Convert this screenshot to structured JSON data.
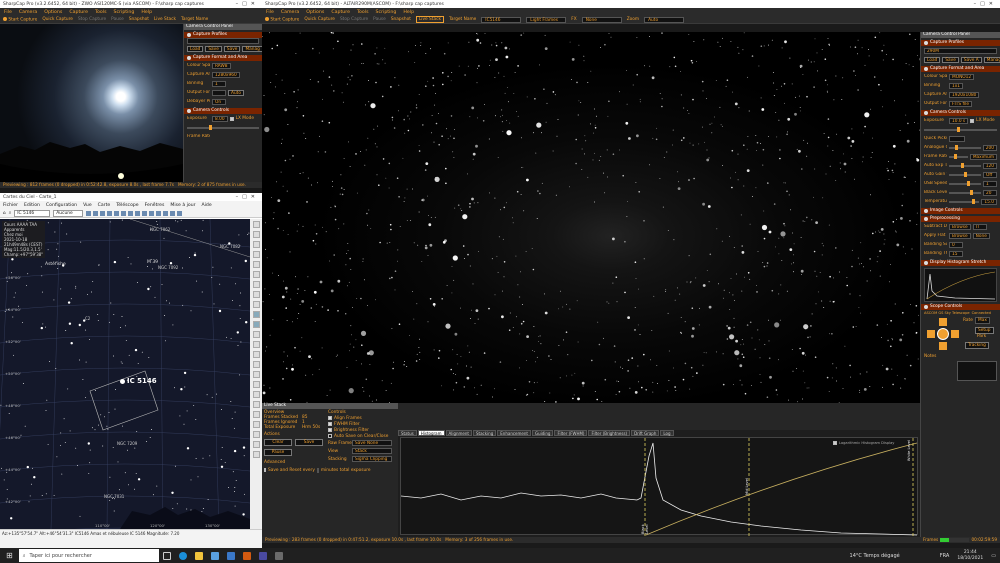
{
  "left_window": {
    "title": "SharpCap Pro (v3.2.6452, 64 bit) - ZWO ASI120MC-S (via ASCOM) - F:\\sharp cap captures",
    "menu": [
      "File",
      "Camera",
      "Options",
      "Capture",
      "Tools",
      "Scripting",
      "Help"
    ],
    "toolbar": {
      "start": "Start Capture",
      "quick": "Quick Capture",
      "stop": "Stop Capture",
      "pause": "Pause",
      "snapshot": "Snapshot",
      "live": "Live Stack",
      "target": "Target Name"
    },
    "panel": {
      "title": "Camera Control Panel",
      "profiles": "Capture Profiles",
      "buttons": [
        "Load",
        "Save",
        "Save",
        "Manag"
      ],
      "format_header": "Capture Format and Area",
      "rows": [
        {
          "label": "Colour Space",
          "value": "RAW8"
        },
        {
          "label": "Capture Area",
          "value": "1280x960"
        },
        {
          "label": "Binning",
          "value": "1"
        },
        {
          "label": "Output Format",
          "value": "",
          "btn": "Auto"
        },
        {
          "label": "Debayer Preview",
          "value": "On"
        }
      ],
      "controls_header": "Camera Controls",
      "exposure_label": "Exposure",
      "exposure_value": "8.00",
      "lx": "LX Mode",
      "frame_rate": "Frame Rate"
    },
    "status": "Previewing : 812 frames (0 dropped) in 0:52:42.8, exposure 8.0s , last frame 7.7s",
    "memory": "Memory: 2 of 875 frames in use."
  },
  "cdc_window": {
    "title": "Cartes du Ciel - Carte_1",
    "menu": [
      "Fichier",
      "Edition",
      "Configuration",
      "Vue",
      "Carte",
      "Téléscope",
      "Fenêtres",
      "Mise à jour",
      "Aide"
    ],
    "search_value": "IC 5146",
    "projection": "Aucune",
    "info": [
      "Cours AAAA TAA",
      "Apparents",
      "Chez moi",
      "2021-10-18",
      "21h49m48s (CEST)",
      "Mag:11.5/20.3,1.5'",
      "Champ:+97°59'38\""
    ],
    "labels": {
      "asterisme": "Astéfishe",
      "ngc7062": "NGC 7062",
      "m39": "M 39",
      "ngc7082": "NGC 7082",
      "ngc7092": "NGC 7092",
      "target": "IC 5146",
      "ngc7209": "NGC 7209",
      "ngc7031": "NGC 7031",
      "c2": "C2"
    },
    "dec_labels": [
      "+56°00'",
      "+54°00'",
      "+52°00'",
      "+50°00'",
      "+48°00'",
      "+46°00'",
      "+44°00'",
      "+42°00'",
      "+40°00'"
    ],
    "ra_labels": [
      "110°00'",
      "120°00'",
      "130°00'"
    ],
    "status": "Az:+135°57'54.7\" Alt:+46°54'31.3\"   IC5146  Amas et nébuleuse  IC 5146  Magnitude: 7.20"
  },
  "right_window": {
    "title": "SharpCap Pro (v3.2.6452, 64 bit) - ALTAIR290M(ASCOM) - F:\\sharp cap captures",
    "menu": [
      "File",
      "Camera",
      "Options",
      "Capture",
      "Tools",
      "Scripting",
      "Help"
    ],
    "toolbar": {
      "start": "Start Capture",
      "quick": "Quick Capture",
      "stop": "Stop Capture",
      "pause": "Pause",
      "snapshot": "Snapshot",
      "live": "Live Stack",
      "target_label": "Target Name",
      "target_value": "IC5146",
      "frames": "Light Frames",
      "fx_label": "FX",
      "fx_value": "None",
      "zoom_label": "Zoom",
      "zoom_value": "Auto"
    },
    "panel": {
      "title": "Camera Control Panel",
      "profiles": "Capture Profiles",
      "profile_value": "290M",
      "buttons": [
        "Load",
        "Save",
        "Save A",
        "Manag"
      ],
      "format_header": "Capture Format and Area",
      "format_rows": [
        {
          "label": "Colour Space",
          "value": "MONO12"
        },
        {
          "label": "Binning",
          "value": "1x1"
        },
        {
          "label": "Capture Area",
          "value": "1920x1080"
        },
        {
          "label": "Output Format",
          "value": "FITS file"
        }
      ],
      "controls_header": "Camera Controls",
      "exposure": {
        "label": "Exposure",
        "value": "10.0 s",
        "lx": "LX Mode"
      },
      "quick_picks": "Quick Picks",
      "control_rows": [
        {
          "label": "Analogue Gain",
          "value": "200"
        },
        {
          "label": "Frame Rate Limit",
          "value": "Maximum"
        },
        {
          "label": "Auto Exp Target",
          "value": "120"
        },
        {
          "label": "Auto Gain with Auto Exposure",
          "value": "Off"
        },
        {
          "label": "USB Speed",
          "value": "1"
        },
        {
          "label": "Black Level",
          "value": "20"
        },
        {
          "label": "Temperature",
          "value": "15.0"
        }
      ],
      "image_controls": "Image Controls",
      "preprocessing": "Preprocessing",
      "pre_rows": [
        {
          "label": "Subtract Dark",
          "value": "Browse",
          "extra": "IT"
        },
        {
          "label": "Apply Flat",
          "value": "Browse",
          "extra": "None"
        },
        {
          "label": "Banding Suppression",
          "value": "0"
        },
        {
          "label": "Banding Threshold",
          "value": "15"
        }
      ],
      "histogram": "Display Histogram Stretch",
      "scope": "Scope Controls",
      "scope_name": "ASCOM GS Sky Telescope",
      "connected": "Connected",
      "rate_label": "Rate",
      "rate_value": "Max",
      "setup": "Setup",
      "park": "Park",
      "tracking": "Tracking",
      "notes": "Notes"
    },
    "live_stack": {
      "title": "Live Stack",
      "overview": "Overview",
      "stats": [
        {
          "label": "Frames Stacked",
          "value": "85"
        },
        {
          "label": "Frames Ignored",
          "value": "1"
        },
        {
          "label": "Total Exposure",
          "value": "Hrm 50s"
        }
      ],
      "actions": "Actions",
      "clear": "Clear",
      "save": "Save",
      "pause": "Pause",
      "advanced": "Advanced",
      "save_reset": "Save and Reset every",
      "minutes": "minutes total exposure",
      "controls": "Controls",
      "checks": [
        {
          "label": "Align Frames",
          "on": true
        },
        {
          "label": "FWHM Filter",
          "on": true
        },
        {
          "label": "Brightness Filter",
          "on": true
        },
        {
          "label": "Auto Save on Clear/Close",
          "on": false
        }
      ],
      "raw_frames": "Raw Frames",
      "raw_value": "Save None",
      "view": "View",
      "view_value": "Stack",
      "stacking": "Stacking",
      "stacking_value": "Sigma Clipping",
      "tabs": [
        "Status",
        "Histogram",
        "Alignment",
        "Stacking",
        "Enhancement",
        "Guiding",
        "Filter (FWHM)",
        "Filter (Brightness)",
        "Drift Graph",
        "Log"
      ],
      "active_tab": "Histogram",
      "log_label": "Logarithmic Histogram Display",
      "black": "Black Level",
      "white": "White Level",
      "mid": "Mid Level"
    },
    "status": "Previewing : 283 frames (0 dropped) in 0:47:51.2, exposure 10.0s , last frame 10.0s",
    "memory": "Memory: 3 of 256 frames in use.",
    "frames": "Frames",
    "frame_count": "00:02:59:59"
  },
  "taskbar": {
    "search": "Taper ici pour rechercher",
    "weather": "14°C  Temps dégagé",
    "lang": "FRA",
    "time": "21:44",
    "date": "18/10/2021"
  }
}
